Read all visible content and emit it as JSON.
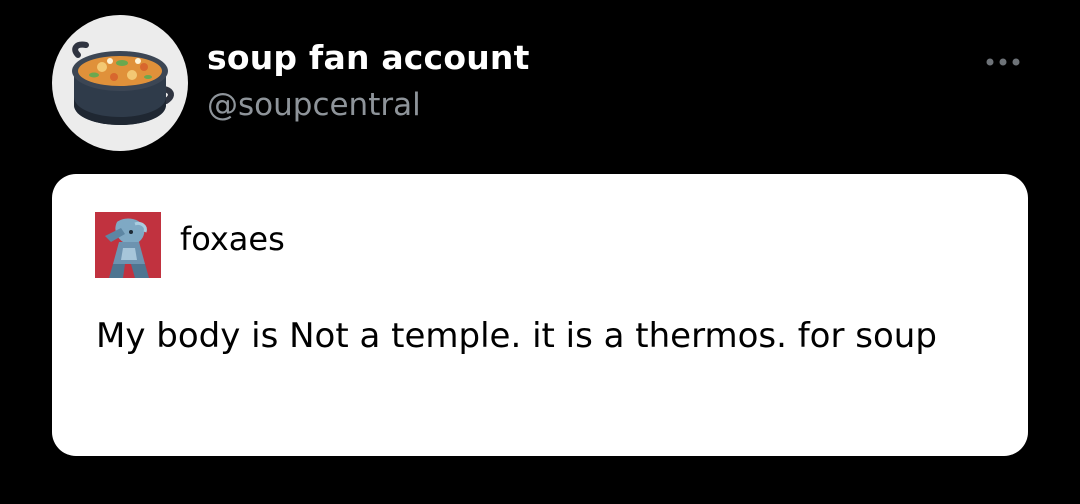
{
  "account": {
    "display_name": "soup fan account",
    "handle": "@soupcentral",
    "avatar_icon": "soup-pot-icon"
  },
  "menu": {
    "icon": "more-options-icon"
  },
  "quoted_post": {
    "author": "foxaes",
    "avatar_icon": "character-avatar",
    "text": "My body is Not a temple. it is a thermos. for soup"
  },
  "colors": {
    "background": "#000000",
    "card": "#ffffff",
    "display_name": "#ffffff",
    "handle": "#8e949a",
    "post_avatar_bg": "#c1323f"
  }
}
